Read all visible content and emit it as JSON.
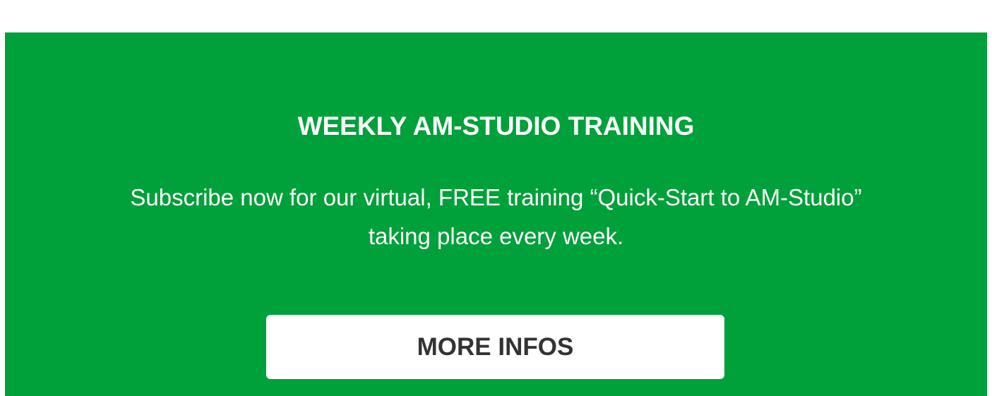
{
  "colors": {
    "banner_background": "#00a03a",
    "page_background": "#ffffff",
    "heading_text": "#ffffff",
    "button_background": "#ffffff",
    "button_text": "#333333"
  },
  "banner": {
    "title": "WEEKLY AM-STUDIO TRAINING",
    "description_line_1": "Subscribe now for our virtual, FREE training “Quick-Start to AM-Studio”",
    "description_line_2": "taking place every week.",
    "button_label": "MORE INFOS"
  }
}
